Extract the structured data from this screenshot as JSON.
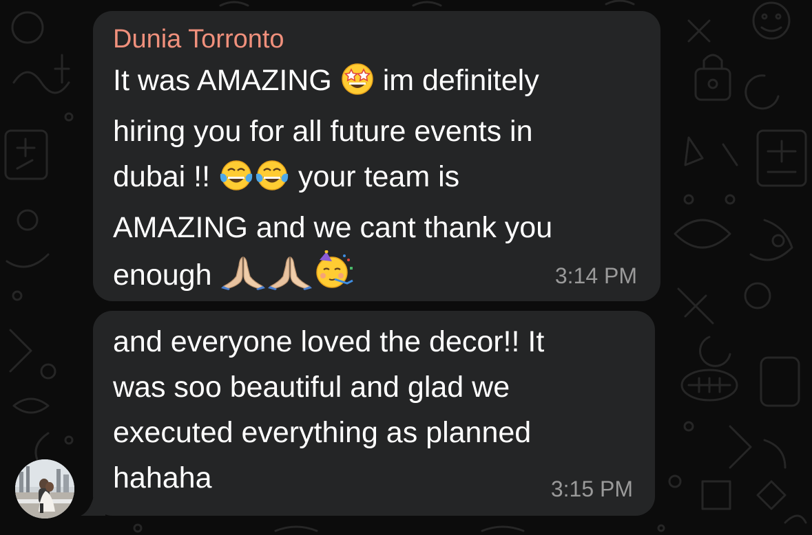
{
  "messages": [
    {
      "sender": "Dunia Torronto",
      "lines": [
        [
          "It was AMAZING ",
          "star-struck-emoji",
          " im definitely"
        ],
        [
          "hiring you for all future events in"
        ],
        [
          "dubai !! ",
          "joy-emoji",
          "joy-emoji",
          " your team is"
        ],
        [
          "AMAZING and we cant thank you"
        ],
        [
          "enough ",
          "folded-hands-emoji",
          "folded-hands-emoji",
          "partying-face-emoji"
        ]
      ],
      "line1_a": "It was AMAZING",
      "line1_b": "im definitely",
      "line2": "hiring you for all future events in",
      "line3_a": "dubai !!",
      "line3_b": "your team is",
      "line4": "AMAZING and we cant thank you",
      "line5": "enough",
      "time": "3:14 PM"
    },
    {
      "line1": "and everyone loved the decor!! It",
      "line2": "was soo beautiful and glad we",
      "line3": "executed everything as planned",
      "line4": "hahaha",
      "time": "3:15 PM"
    }
  ],
  "colors": {
    "background": "#0c0c0c",
    "bubble": "#242526",
    "sender_name": "#f0907c",
    "text": "#ffffff",
    "timestamp": "#9a9a9a"
  },
  "icons": {
    "star_struck": "star-struck-emoji",
    "joy": "joy-emoji",
    "folded_hands": "folded-hands-emoji",
    "partying_face": "partying-face-emoji"
  }
}
